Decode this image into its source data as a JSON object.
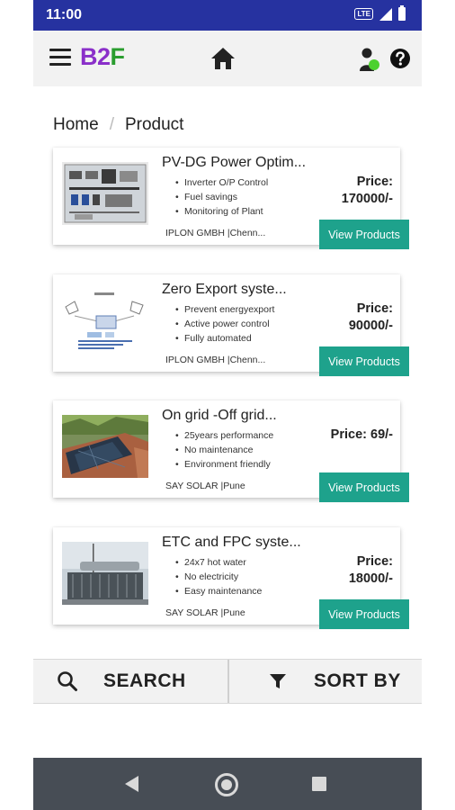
{
  "status_bar": {
    "time": "11:00",
    "network": "LTE"
  },
  "app_bar": {
    "logo_b": "B",
    "logo_2": "2",
    "logo_f": "F",
    "icons": [
      "menu-icon",
      "home-icon",
      "profile-icon",
      "help-icon"
    ]
  },
  "breadcrumb": {
    "home": "Home",
    "separator": "/",
    "current": "Product"
  },
  "products": [
    {
      "title": "PV-DG Power Optim...",
      "features": [
        "Inverter O/P Control",
        "Fuel savings",
        "Monitoring of Plant"
      ],
      "seller": "IPLON GMBH |Chenn...",
      "price_label": "Price:",
      "price_value": "170000/-",
      "button": "View Products"
    },
    {
      "title": "Zero Export syste...",
      "features": [
        "Prevent energyexport",
        "Active power control",
        "Fully automated"
      ],
      "seller": "IPLON GMBH |Chenn...",
      "price_label": "Price:",
      "price_value": "90000/-",
      "button": "View Products"
    },
    {
      "title": "On grid -Off grid...",
      "features": [
        "25years performance",
        "No maintenance",
        "Environment friendly"
      ],
      "seller": "SAY SOLAR |Pune",
      "price_label": "Price: 69/-",
      "price_value": "",
      "button": "View Products"
    },
    {
      "title": "ETC and FPC syste...",
      "features": [
        "24x7 hot water",
        "No electricity",
        "Easy maintenance"
      ],
      "seller": "SAY SOLAR |Pune",
      "price_label": "Price:",
      "price_value": "18000/-",
      "button": "View Products"
    }
  ],
  "actions": {
    "search": "SEARCH",
    "sort": "SORT BY"
  },
  "colors": {
    "status_bar": "#2632a0",
    "accent_button": "#1ea28c",
    "logo_purple": "#8a2fc9",
    "logo_green": "#2a9d2f",
    "nav_bar": "#474d55"
  }
}
